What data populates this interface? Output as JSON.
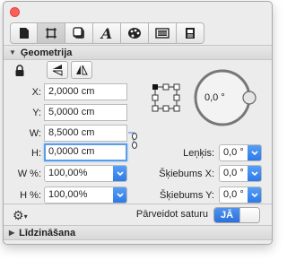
{
  "tabs": [
    {
      "name": "document-tab",
      "glyph": "■"
    },
    {
      "name": "geometry-tab",
      "glyph": "⌑"
    },
    {
      "name": "shadow-tab",
      "glyph": "▣"
    },
    {
      "name": "text-tab",
      "glyph": "A"
    },
    {
      "name": "palette-tab",
      "glyph": "◕"
    },
    {
      "name": "image-tab",
      "glyph": "▤"
    },
    {
      "name": "properties-tab",
      "glyph": "▥"
    }
  ],
  "geometry": {
    "section_title": "Ģeometrija",
    "x_label": "X:",
    "x_value": "2,0000 cm",
    "y_label": "Y:",
    "y_value": "5,0000 cm",
    "w_label": "W:",
    "w_value": "8,5000 cm",
    "h_label": "H:",
    "h_value": "0,0000 cm",
    "wpct_label": "W %:",
    "wpct_value": "100,00%",
    "hpct_label": "H %:",
    "hpct_value": "100,00%",
    "rotation_dial_value": "0,0 °",
    "angle_label": "Leņķis:",
    "angle_value": "0,0 °",
    "skew_x_label": "Šķiebums X:",
    "skew_x_value": "0,0 °",
    "skew_y_label": "Šķiebums Y:",
    "skew_y_value": "0,0 °"
  },
  "bottom": {
    "transform_label": "Pārveidot saturu",
    "toggle_on": "JĀ"
  },
  "alignment": {
    "section_title": "Līdzināšana"
  },
  "colors": {
    "accent": "#2c7be5",
    "close": "#fc5f57"
  }
}
